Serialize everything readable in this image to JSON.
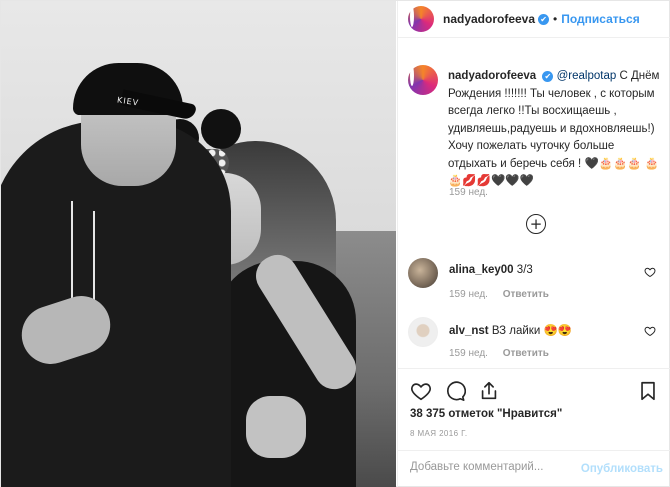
{
  "photo": {
    "cap_text": "KIEV",
    "alt": ""
  },
  "header": {
    "username": "nadyadorofeeva",
    "verified": "✔",
    "separator": "•",
    "follow_label": "Подписаться"
  },
  "caption": {
    "username": "nadyadorofeeva",
    "verified": "✔",
    "mention": "@realpotap",
    "text": " С Днём Рождения !!!!!!! Ты человек , с которым всегда легко !!Ты восхищаешь , удивляешь,радуешь и вдохновляешь!) Хочу пожелать чуточку больше отдыхать и беречь себя ! 🖤🎂🎂🎂 🎂🎂💋💋🖤🖤🖤",
    "time": "159 нед."
  },
  "load_more": "+",
  "comments": [
    {
      "username": "alina_key00",
      "text": "3/3",
      "time": "159 нед.",
      "reply_label": "Ответить"
    },
    {
      "username": "alv_nst",
      "text": "ВЗ лайки 😍😍",
      "time": "159 нед.",
      "reply_label": "Ответить"
    }
  ],
  "likes_text": "38 375 отметок \"Нравится\"",
  "date_text": "8 МАЯ 2016 Г.",
  "add_comment": {
    "placeholder": "Добавьте комментарий...",
    "publish_label": "Опубликовать"
  },
  "colors": {
    "accent": "#3897f0",
    "muted": "#999999",
    "publish_disabled": "#b2dffc"
  }
}
